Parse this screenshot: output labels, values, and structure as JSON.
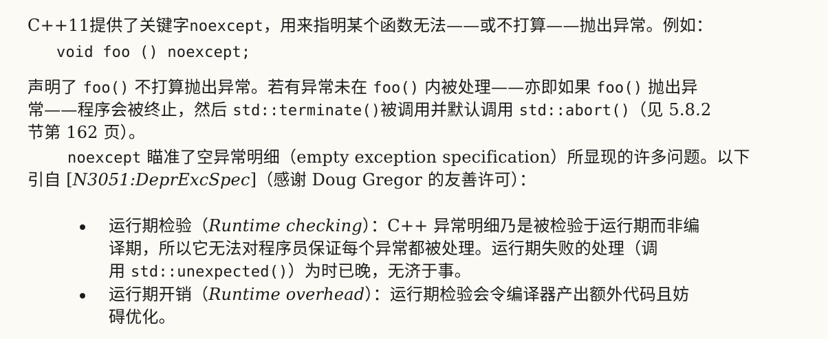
{
  "p1": {
    "a": "C++11提供了关键字",
    "kw": "noexcept",
    "b": "，用来指明某个函数无法——或不打算——抛出异常。例如："
  },
  "code": "void foo () noexcept;",
  "p2": {
    "l1_a": "声明了 ",
    "l1_code1": "foo()",
    "l1_b": " 不打算抛出异常。若有异常未在 ",
    "l1_code2": "foo()",
    "l1_c": " 内被处理——亦即如果 ",
    "l1_code3": "foo()",
    "l1_d": " 抛出异",
    "l2_a": "常——程序会被终止，然后 ",
    "l2_code1": "std::terminate()",
    "l2_b": "被调用并默认调用 ",
    "l2_code2": "std::abort()",
    "l2_c": "（见 5.8.2",
    "l3": "节第 162 页）。"
  },
  "p3": {
    "l1_code": "noexcept",
    "l1_a": " 瞄准了空异常明细（empty exception specification）所显现的许多问题。以下",
    "l2_a": "引自 [",
    "l2_ref": "N3051:DeprExcSpec",
    "l2_b": "]（感谢 Doug Gregor 的友善许可）："
  },
  "bullets": [
    {
      "l1_a": "运行期检验（",
      "l1_ital": "Runtime checking",
      "l1_b": "）：C++ 异常明细乃是被检验于运行期而非编",
      "l2": "译期，所以它无法对程序员保证每个异常都被处理。运行期失败的处理（调",
      "l3_a": "用 ",
      "l3_code": "std::unexpected()",
      "l3_b": "）为时已晚，无济于事。"
    },
    {
      "l1_a": "运行期开销（",
      "l1_ital": "Runtime overhead",
      "l1_b": "）：运行期检验会令编译器产出额外代码且妨",
      "l2": "碍优化。"
    }
  ]
}
